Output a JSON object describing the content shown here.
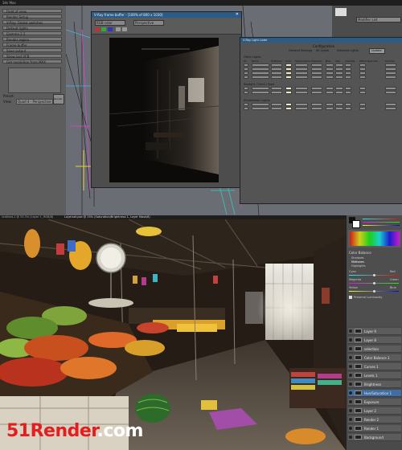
{
  "max": {
    "app_title": "3ds Max",
    "vray_frame_buffer": {
      "title": "V-Ray frame buffer - [100% of 800 x 1030]",
      "channel_select": "RGB color",
      "viewport_label": "Perspective"
    },
    "light_lister": {
      "title": "V-Ray Light Lister",
      "configuration_label": "Configuration",
      "mode_options": [
        "General Settings",
        "All Lights",
        "Selected Lights"
      ],
      "update_button": "Update",
      "groups": [
        {
          "label": "Other Lights",
          "rows": 4
        },
        {
          "label": "Skylight / Omni / Spot",
          "rows": 2
        },
        {
          "label": "Photometric Lights",
          "rows": 2
        }
      ],
      "column_headers": [
        "On",
        "Name",
        "Multiplier",
        "Color",
        "Temperature",
        "Shadows",
        "Bias",
        "Size",
        "Invisible",
        "Affect Specular",
        "Subdivs"
      ]
    },
    "left_panel": {
      "rows": [
        "Field of view",
        "Render Setup",
        "V-Ray: Global switches",
        "Default lights",
        "Gamma 2.2",
        "Render region",
        "Frame buffer",
        "Save output",
        "Show last VFB",
        "Get resolution from MAX"
      ],
      "preset_label": "Preset:",
      "view_label": "View:",
      "view_value": "Quad 4 - Perspective",
      "render_button": "Render"
    },
    "command_panel": {
      "label": "Modifier List"
    }
  },
  "ps": {
    "tabs": [
      "Untitled-1 @ 33.3% (Layer 1, RGB/8)",
      "Layerset.psd @ 25% (Saturation/Brightness 1, Layer Mask/8)"
    ],
    "adjust_panel_title": "Color Balance",
    "tone_options": [
      "Shadows",
      "Midtones",
      "Highlights"
    ],
    "tone_selected": "Midtones",
    "balance": [
      {
        "left": "Cyan",
        "right": "Red",
        "value": "0"
      },
      {
        "left": "Magenta",
        "right": "Green",
        "value": "0"
      },
      {
        "left": "Yellow",
        "right": "Blue",
        "value": "0"
      }
    ],
    "preserve_label": "Preserve Luminosity",
    "layers": [
      "Layer 9",
      "Layer 8",
      "selection",
      "Color Balance 1",
      "Curves 1",
      "Levels 1",
      "Brightness",
      "Hue/Saturation 1",
      "Exposure",
      "Layer 2",
      "Render 2",
      "Render 1",
      "Background"
    ],
    "selected_layer": "Hue/Saturation 1"
  },
  "watermark": {
    "part_a": "51Render",
    "part_b": ".com"
  },
  "colors": {
    "brand_red": "#e41e1e",
    "title_blue": "#2b5c88",
    "max_grey": "#5a5a5a",
    "ps_dark": "#3a3a3a"
  }
}
